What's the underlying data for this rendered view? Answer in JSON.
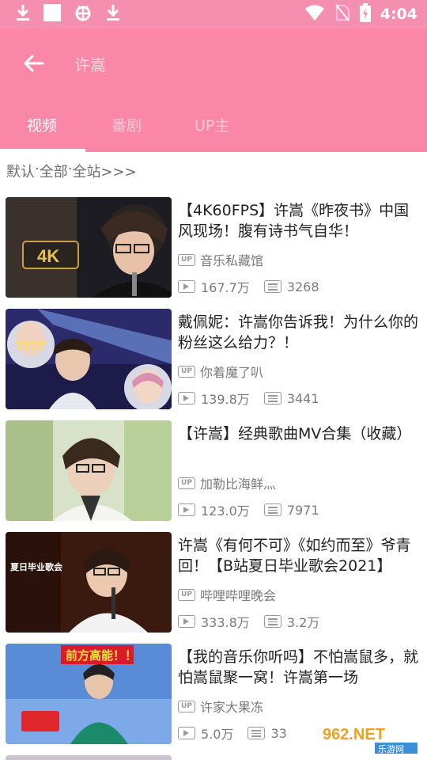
{
  "status_bar": {
    "time": "4:04"
  },
  "header": {
    "search_query": "许嵩"
  },
  "tabs": [
    {
      "label": "视频"
    },
    {
      "label": "番剧"
    },
    {
      "label": "UP主"
    }
  ],
  "filter": {
    "sort": "默认",
    "category": "全部",
    "scope": "全站>>>",
    "sep": " · "
  },
  "up_badge_text": "UP",
  "videos": [
    {
      "title": "【4K60FPS】许嵩《昨夜书》中国风现场！腹有诗书气自华！",
      "uploader": "音乐私藏馆",
      "views": "167.7万",
      "danmaku": "3268",
      "thumb_caption": "4K"
    },
    {
      "title": "戴佩妮：许嵩你告诉我！为什么你的粉丝这么给力？！",
      "uploader": "你着魔了叭",
      "views": "139.8万",
      "danmaku": "3441",
      "thumb_caption": "????"
    },
    {
      "title": "【许嵩】经典歌曲MV合集（收藏）",
      "uploader": "加勒比海鲜灬",
      "views": "123.0万",
      "danmaku": "7971",
      "thumb_caption": ""
    },
    {
      "title": "许嵩《有何不可》《如约而至》爷青回！【B站夏日毕业歌会2021】",
      "uploader": "哔哩哔哩晚会",
      "views": "333.8万",
      "danmaku": "3.2万",
      "thumb_caption": "夏日毕业歌会"
    },
    {
      "title": "【我的音乐你听吗】不怕嵩鼠多，就怕嵩鼠聚一窝！许嵩第一场",
      "uploader": "许家大果冻",
      "views": "5.0万",
      "danmaku": "33",
      "thumb_caption": "前方高能！！"
    }
  ],
  "watermark": {
    "text": "962.NET",
    "sub": "乐游网"
  },
  "colors": {
    "header": "#fb87a8",
    "status": "#f58fb0",
    "tab_active": "#ffffff",
    "tab_inactive": "#fcc9d8"
  },
  "icons": [
    "download-icon",
    "image-icon",
    "bug-icon",
    "wifi-icon",
    "no-sim-icon",
    "battery-charging-icon",
    "back-arrow-icon",
    "play-count-icon",
    "danmaku-icon",
    "up-badge-icon"
  ]
}
